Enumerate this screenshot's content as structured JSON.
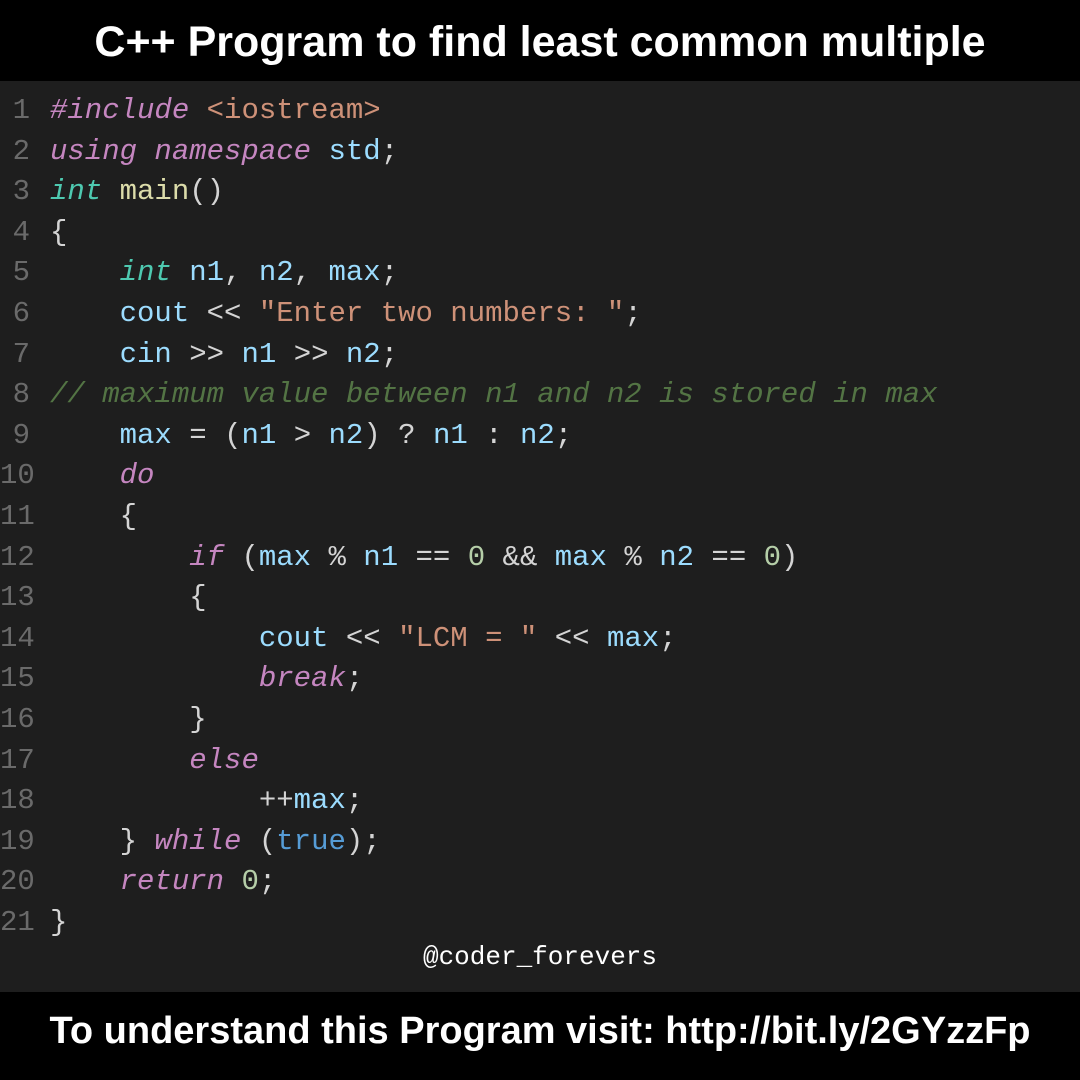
{
  "title": "C++ Program to find least common multiple",
  "handle": "@coder_forevers",
  "footer": "To understand this Program visit: http://bit.ly/2GYzzFp",
  "code": {
    "include_kw": "#include",
    "iostream": "<iostream>",
    "using": "using",
    "namespace": "namespace",
    "std": "std",
    "int": "int",
    "main": "main",
    "n1": "n1",
    "n2": "n2",
    "max": "max",
    "cout": "cout",
    "cin": "cin",
    "enter_str": "\"Enter two numbers: \"",
    "comment": "// maximum value between n1 and n2 is stored in max",
    "do": "do",
    "if": "if",
    "zero": "0",
    "lcm_str": "\"LCM = \"",
    "break": "break",
    "else": "else",
    "while": "while",
    "true": "true",
    "return": "return"
  },
  "ln": {
    "1": "1",
    "2": "2",
    "3": "3",
    "4": "4",
    "5": "5",
    "6": "6",
    "7": "7",
    "8": "8",
    "9": "9",
    "10": "10",
    "11": "11",
    "12": "12",
    "13": "13",
    "14": "14",
    "15": "15",
    "16": "16",
    "17": "17",
    "18": "18",
    "19": "19",
    "20": "20",
    "21": "21"
  }
}
